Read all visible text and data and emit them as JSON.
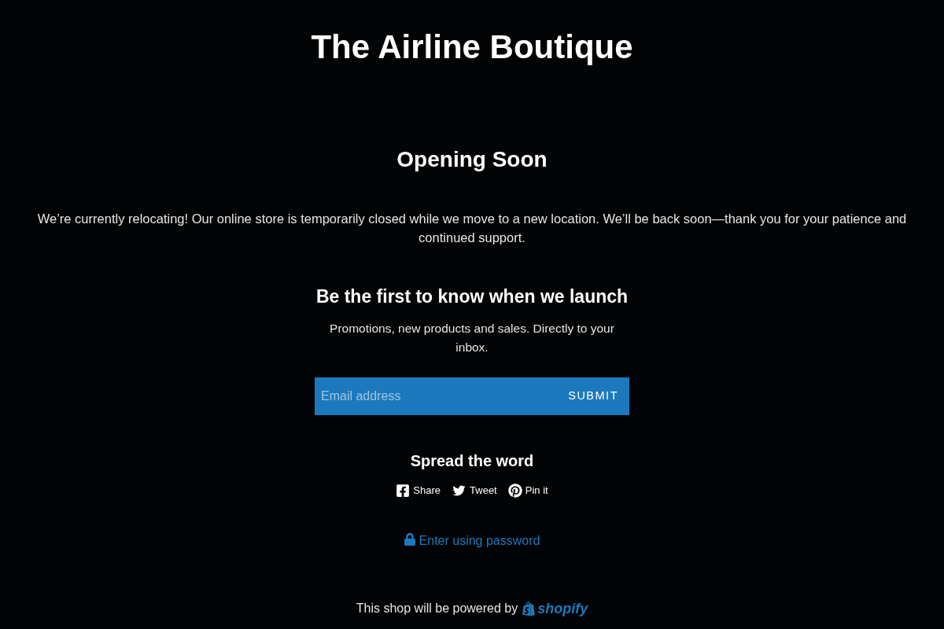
{
  "store_title": "The Airline Boutique",
  "heading": "Opening Soon",
  "message": "We’re currently relocating! Our online store is temporarily closed while we move to a new location. We’ll be back soon—thank you for your patience and continued support.",
  "newsletter": {
    "heading": "Be the first to know when we launch",
    "subtext": "Promotions, new products and sales. Directly to your inbox.",
    "email_field": {
      "placeholder": "Email address"
    },
    "submit_button": "SUBMIT"
  },
  "share": {
    "heading": "Spread the word",
    "links": [
      {
        "kind": "facebook",
        "label": "Share"
      },
      {
        "kind": "twitter",
        "label": "Tweet"
      },
      {
        "kind": "pinterest",
        "label": "Pin it"
      }
    ]
  },
  "password_link": "Enter using password",
  "footer": {
    "text": "This shop will be powered by",
    "logo_text": "shopify"
  }
}
